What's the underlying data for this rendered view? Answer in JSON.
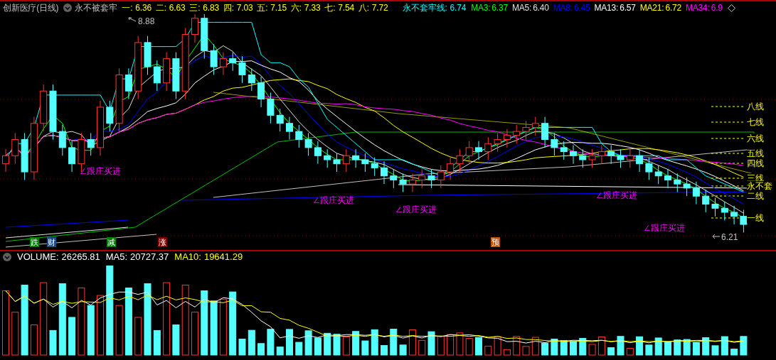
{
  "header": {
    "stock": "创新医疗(日线)",
    "indicator": "永不被套牢",
    "levels": [
      {
        "label": "一:",
        "value": "6.36"
      },
      {
        "label": "二:",
        "value": "6.63"
      },
      {
        "label": "三:",
        "value": "6.83"
      },
      {
        "label": "四:",
        "value": "7.03"
      },
      {
        "label": "五:",
        "value": "7.15"
      },
      {
        "label": "六:",
        "value": "7.33"
      },
      {
        "label": "七:",
        "value": "7.54"
      },
      {
        "label": "八:",
        "value": "7.72"
      }
    ],
    "line_value": {
      "label": "永不套牢线:",
      "value": "6.74"
    },
    "mas": [
      {
        "label": "MA3:",
        "value": "6.37",
        "color": "#00ff00"
      },
      {
        "label": "MA5:",
        "value": "6.40",
        "color": "#e0e0e0"
      },
      {
        "label": "MA8:",
        "value": "6.45",
        "color": "#0000ff"
      },
      {
        "label": "MA13:",
        "value": "6.57",
        "color": "#ffffff"
      },
      {
        "label": "MA21:",
        "value": "6.72",
        "color": "#ffff00"
      },
      {
        "label": "MA34:",
        "value": "6.9",
        "color": "#ff00ff"
      }
    ]
  },
  "chart": {
    "high_label": "8.88",
    "low_label": "6.21",
    "signals": [
      "∠跟庄买进",
      "∠跟庄买进",
      "∠跟庄买进",
      "∠跟庄买进",
      "∠跟庄买进"
    ],
    "markers": [
      {
        "text": "跌",
        "color": "#008000"
      },
      {
        "text": "财",
        "color": "#1a4a8a"
      },
      {
        "text": "减",
        "color": "#008000"
      },
      {
        "text": "涨",
        "color": "#800000"
      },
      {
        "text": "预",
        "color": "#c05000"
      }
    ],
    "line_labels": [
      "八线",
      "七线",
      "六线",
      "五线",
      "四线",
      "三线",
      "永不套",
      "二线",
      "一线"
    ]
  },
  "volume": {
    "title": "VOLUME:",
    "value": "26265.81",
    "mas": [
      {
        "label": "MA5:",
        "value": "20727.37",
        "color": "#ffffff"
      },
      {
        "label": "MA10:",
        "value": "19641.29",
        "color": "#ffff00"
      }
    ]
  }
}
